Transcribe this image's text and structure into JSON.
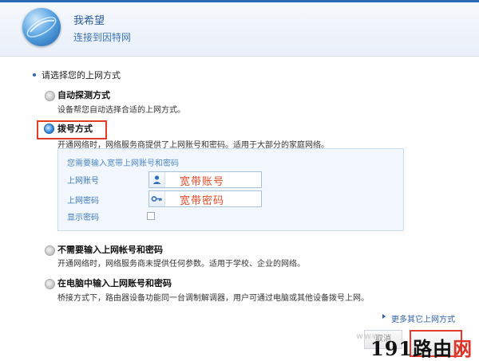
{
  "header": {
    "title": "我希望",
    "subtitle": "连接到因特网"
  },
  "section_title": "请选择您的上网方式",
  "options": [
    {
      "title": "自动探测方式",
      "desc": "设备帮您自动选择合适的上网方式。"
    },
    {
      "title": "拨号方式",
      "desc": "开通网络时，网络服务商提供了上网账号和密码。适用于大部分的家庭网络。"
    },
    {
      "title": "不需要输入上网帐号和密码",
      "desc": "开通网络时，网络服务商未提供任何参数。适用于学校、企业的网络。"
    },
    {
      "title": "在电脑中输入上网账号和密码",
      "desc": "桥接方式下，路由器设备功能同一台调制解调器，用户可通过电脑或其他设备拨号上网。"
    }
  ],
  "dialup": {
    "hint": "您需要输入宽带上网账号和密码",
    "account_label": "上网账号",
    "account_value": "宽带账号",
    "password_label": "上网密码",
    "password_value": "宽带密码",
    "show_password_label": "显示密码",
    "show_password_checked": false
  },
  "selected_option": 1,
  "more_link": "更多其它上网方式",
  "buttons": {
    "prev": "取消",
    "next": ""
  },
  "watermark": {
    "prefix": "www.",
    "number": "191",
    "text_black": "路由",
    "text_red": "网"
  },
  "colors": {
    "accent": "#2a6ab7",
    "highlight": "#e43a2a",
    "field_value": "#e44a2a"
  }
}
